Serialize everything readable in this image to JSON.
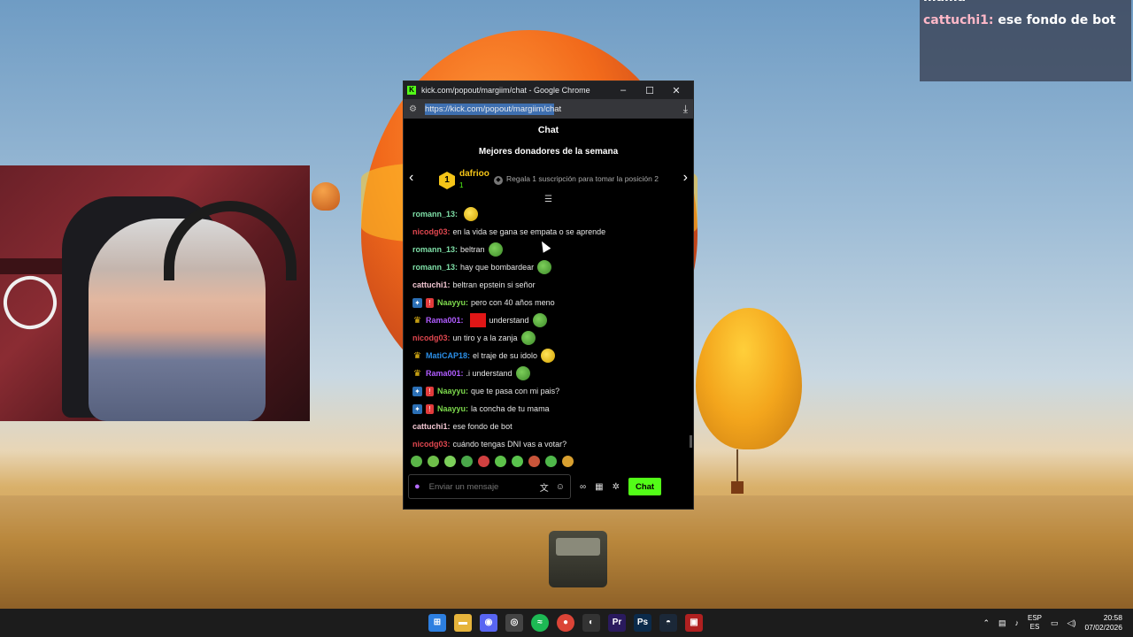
{
  "window": {
    "title": "kick.com/popout/margiim/chat - Google Chrome",
    "url_selected": "https://kick.com/popout/margiim/ch",
    "url_rest": "at",
    "minimize": "–",
    "maximize": "☐",
    "close": "✕"
  },
  "chat": {
    "header": "Chat",
    "donors_title": "Mejores donadores de la semana",
    "top_donor": {
      "rank": "1",
      "name": "dafrioo",
      "count": "1"
    },
    "gift_text": "Regala 1 suscripción para tomar la posición 2",
    "messages": [
      {
        "user": "romann_13",
        "color": "#7fe0a8",
        "text": "",
        "emote": "yellow"
      },
      {
        "user": "nicodg03",
        "color": "#e0474f",
        "text": "en la vida se gana se empata o se aprende"
      },
      {
        "user": "romann_13",
        "color": "#7fe0a8",
        "text": "beltran",
        "emote": "frog"
      },
      {
        "user": "romann_13",
        "color": "#7fe0a8",
        "text": "hay que bombardear",
        "emote": "frog"
      },
      {
        "user": "cattuchi1",
        "color": "#f2c6d2",
        "text": "beltran epstein si señor"
      },
      {
        "user": "Naayyu",
        "color": "#7dd94c",
        "text": "pero con 40 años meno",
        "badges": [
          "vip",
          "mod"
        ]
      },
      {
        "user": "Rama001",
        "color": "#b05cff",
        "text": "understand",
        "badges": [
          "crown"
        ],
        "redsq": true,
        "emote": "frog"
      },
      {
        "user": "nicodg03",
        "color": "#e0474f",
        "text": "un tiro y a la zanja",
        "emote": "frog"
      },
      {
        "user": "MatiCAP18",
        "color": "#2b8fe8",
        "text": "el traje de su idolo",
        "badges": [
          "crown"
        ],
        "emote": "yellow"
      },
      {
        "user": "Rama001",
        "color": "#b05cff",
        "text": ".i understand",
        "badges": [
          "crown"
        ],
        "emote": "frog"
      },
      {
        "user": "Naayyu",
        "color": "#7dd94c",
        "text": "que te pasa con mi pais?",
        "badges": [
          "vip",
          "mod"
        ]
      },
      {
        "user": "Naayyu",
        "color": "#7dd94c",
        "text": "la concha de tu mama",
        "badges": [
          "vip",
          "mod"
        ]
      },
      {
        "user": "cattuchi1",
        "color": "#f2c6d2",
        "text": "ese fondo de bot"
      },
      {
        "user": "nicodg03",
        "color": "#e0474f",
        "text": "cuándo tengas DNI vas a votar?"
      }
    ],
    "input_placeholder": "Enviar un mensaje",
    "send_label": "Chat"
  },
  "overlay": {
    "prev_line": "mama",
    "user": "cattuchi1:",
    "text": "ese fondo de bot"
  },
  "taskbar": {
    "lang_top": "ESP",
    "lang_bottom": "ES",
    "time": "20:58",
    "date": "07/02/2026"
  },
  "colors": {
    "kick_green": "#53fc18",
    "chat_bg": "#000000"
  }
}
